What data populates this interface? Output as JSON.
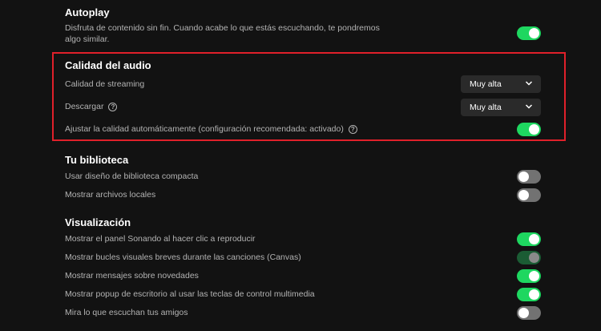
{
  "autoplay": {
    "title": "Autoplay",
    "desc_line1": "Disfruta de contenido sin fin. Cuando acabe lo que estás escuchando, te pondremos",
    "desc_line2": "algo similar.",
    "toggle_on": true
  },
  "audio_quality": {
    "title": "Calidad del audio",
    "streaming_label": "Calidad de streaming",
    "streaming_value": "Muy alta",
    "download_label": "Descargar",
    "download_value": "Muy alta",
    "auto_adjust_label": "Ajustar la calidad automáticamente (configuración recomendada: activado)",
    "auto_adjust_on": true,
    "help_glyph": "?"
  },
  "library": {
    "title": "Tu biblioteca",
    "compact_label": "Usar diseño de biblioteca compacta",
    "compact_on": false,
    "local_files_label": "Mostrar archivos locales",
    "local_files_on": false
  },
  "display": {
    "title": "Visualización",
    "now_playing_label": "Mostrar el panel Sonando al hacer clic a reproducir",
    "now_playing_on": true,
    "canvas_label": "Mostrar bucles visuales breves durante las canciones (Canvas)",
    "canvas_on": true,
    "news_label": "Mostrar mensajes sobre novedades",
    "news_on": true,
    "popup_label": "Mostrar popup de escritorio al usar las teclas de control multimedia",
    "popup_on": true,
    "friends_label": "Mira lo que escuchan tus amigos",
    "friends_on": false
  },
  "colors": {
    "accent_green": "#1ed760",
    "highlight_red": "#e0202a",
    "background": "#121212"
  }
}
